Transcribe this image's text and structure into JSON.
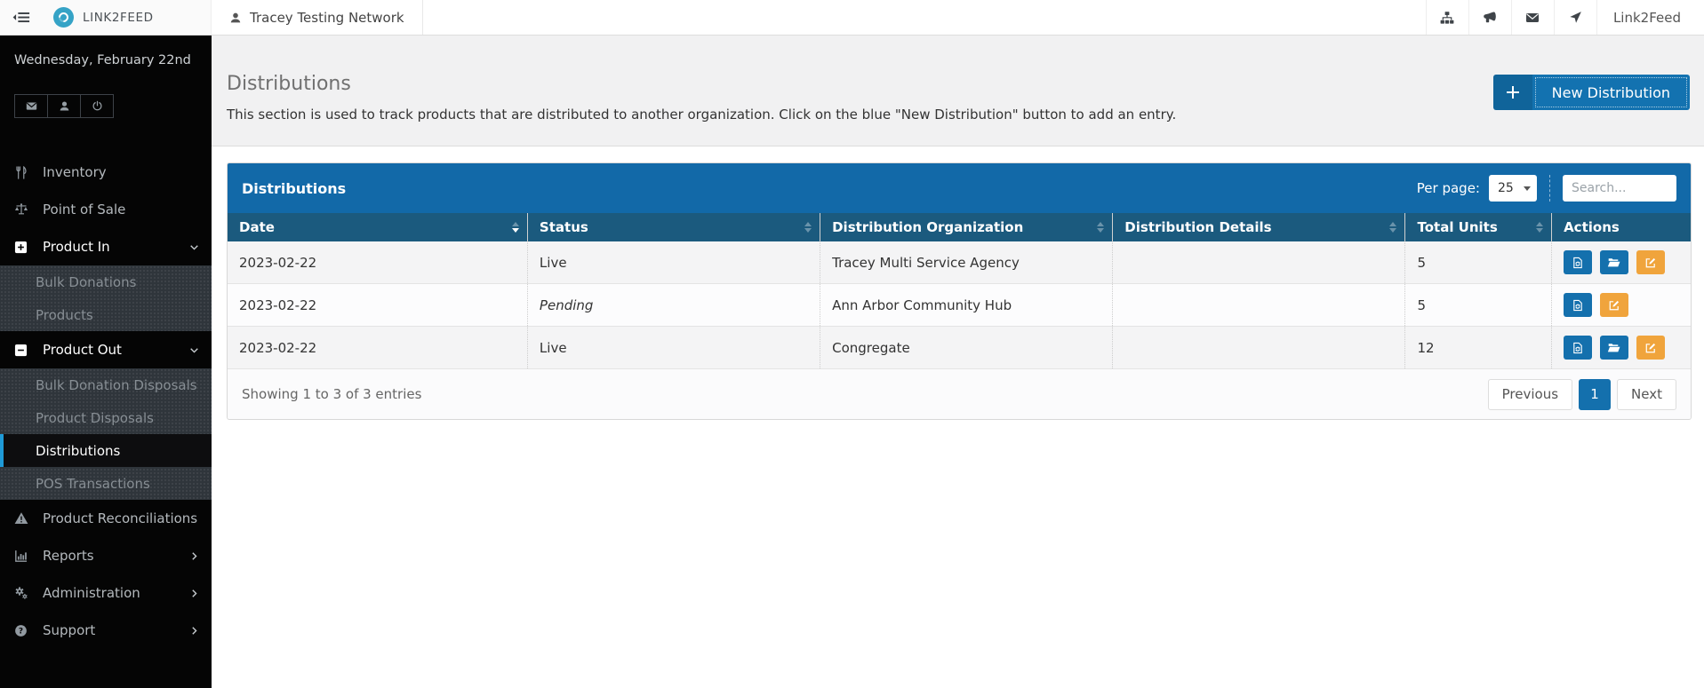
{
  "topbar": {
    "brand": "LINK2FEED",
    "network": "Tracey Testing Network",
    "right_icons": [
      "sitemap-icon",
      "megaphone-icon",
      "envelope-icon",
      "location-arrow-icon"
    ],
    "right_label": "Link2Feed"
  },
  "sidebar": {
    "date": "Wednesday, February 22nd",
    "quick_icons": [
      "envelope-icon",
      "user-icon",
      "power-icon"
    ],
    "menu": [
      {
        "label": "Inventory",
        "icon": "cutlery-icon"
      },
      {
        "label": "Point of Sale",
        "icon": "scale-icon"
      },
      {
        "label": "Product In",
        "icon": "plus-square-icon",
        "state": "expanded"
      },
      {
        "label": "Bulk Donations",
        "submenu_of": "Product In"
      },
      {
        "label": "Products",
        "submenu_of": "Product In"
      },
      {
        "label": "Product Out",
        "icon": "minus-square-icon",
        "state": "expanded"
      },
      {
        "label": "Bulk Donation Disposals",
        "submenu_of": "Product Out"
      },
      {
        "label": "Product Disposals",
        "submenu_of": "Product Out"
      },
      {
        "label": "Distributions",
        "submenu_of": "Product Out",
        "active": true
      },
      {
        "label": "POS Transactions",
        "submenu_of": "Product Out"
      },
      {
        "label": "Product Reconciliations",
        "icon": "warning-icon"
      },
      {
        "label": "Reports",
        "icon": "chart-icon",
        "state": "collapsed"
      },
      {
        "label": "Administration",
        "icon": "gears-icon",
        "state": "collapsed"
      },
      {
        "label": "Support",
        "icon": "question-icon",
        "state": "collapsed"
      }
    ]
  },
  "page": {
    "title": "Distributions",
    "description": "This section is used to track products that are distributed to another organization. Click on the blue \"New Distribution\" button to add an entry.",
    "new_button_label": "New Distribution",
    "new_button_icon": "plus-icon"
  },
  "panel": {
    "title": "Distributions",
    "per_page_label": "Per page:",
    "per_page_value": "25",
    "search_placeholder": "Search..."
  },
  "table": {
    "headers": [
      "Date",
      "Status",
      "Distribution Organization",
      "Distribution Details",
      "Total Units",
      "Actions"
    ],
    "sorted_by": "Date",
    "sort_direction": "desc",
    "rows": [
      {
        "date": "2023-02-22",
        "status": "Live",
        "organization": "Tracey Multi Service Agency",
        "details": "",
        "total_units": "5",
        "actions": [
          "file-sync-icon",
          "folder-open-icon",
          "edit-icon"
        ]
      },
      {
        "date": "2023-02-22",
        "status": "Pending",
        "organization": "Ann Arbor Community Hub",
        "details": "",
        "total_units": "5",
        "actions": [
          "file-sync-icon",
          "edit-icon"
        ]
      },
      {
        "date": "2023-02-22",
        "status": "Live",
        "organization": "Congregate",
        "details": "",
        "total_units": "12",
        "actions": [
          "file-sync-icon",
          "folder-open-icon",
          "edit-icon"
        ]
      }
    ]
  },
  "footer": {
    "showing_text": "Showing 1 to 3 of 3 entries",
    "pagination": {
      "previous": "Previous",
      "current_page": "1",
      "next": "Next"
    }
  },
  "colors": {
    "panel_heading": "#1269a8",
    "table_header": "#1b5a7e",
    "button_blue": "#1372b0",
    "action_blue": "#1470ad",
    "action_orange": "#f0a43c",
    "active_item_border": "#1f9ad7",
    "pagination_active": "#1470ad",
    "logo_teal": "#35a3c6"
  }
}
